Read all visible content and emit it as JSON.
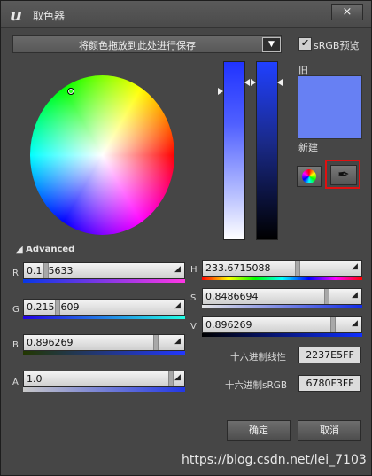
{
  "window": {
    "title": "取色器",
    "close_glyph": "×",
    "logo_glyph": "u"
  },
  "toolbar": {
    "save_label": "将颜色拖放到此处进行保存",
    "dropdown_glyph": "▼",
    "srgb_label": "sRGB预览",
    "srgb_checked": true,
    "check_glyph": "✔"
  },
  "preview": {
    "old_label": "旧",
    "new_label": "新建",
    "color": "#6780f3"
  },
  "tools": {
    "dropper_glyph": "✒"
  },
  "advanced": {
    "label": "Advanced",
    "expanded": true
  },
  "channels": {
    "r": {
      "label": "R",
      "value": "0.135633",
      "level": 0.136
    },
    "g": {
      "label": "G",
      "value": "0.2158609",
      "level": 0.216
    },
    "b": {
      "label": "B",
      "value": "0.896269",
      "level": 0.896
    },
    "a": {
      "label": "A",
      "value": "1.0",
      "level": 1.0
    },
    "h": {
      "label": "H",
      "value": "233.6715088",
      "level": 0.649
    },
    "s": {
      "label": "S",
      "value": "0.8486694",
      "level": 0.849
    },
    "v": {
      "label": "V",
      "value": "0.896269",
      "level": 0.896
    }
  },
  "hex": {
    "linear_label": "十六进制线性",
    "linear_value": "2237E5FF",
    "srgb_label": "十六进制sRGB",
    "srgb_value": "6780F3FF"
  },
  "buttons": {
    "ok": "确定",
    "cancel": "取消"
  },
  "watermark": "https://blog.csdn.net/lei_7103",
  "colors": {
    "accent_red": "#e01010",
    "panel": "#464646"
  }
}
